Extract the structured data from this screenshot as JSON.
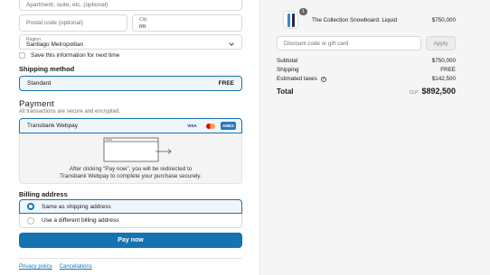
{
  "address": {
    "apartment_placeholder": "Apartment, suite, etc. (optional)",
    "postal_placeholder": "Postal code (optional)",
    "city_label": "City",
    "city_value": "rm",
    "region_label": "Region",
    "region_value": "Santiago Metropolitan",
    "save_info_label": "Save this information for next time"
  },
  "shipping": {
    "title": "Shipping method",
    "method": "Standard",
    "price": "FREE"
  },
  "payment": {
    "title": "Payment",
    "subtitle": "All transactions are secure and encrypted.",
    "method": "Transbank Webpay",
    "cards": [
      "VISA",
      "mastercard",
      "AMEX"
    ],
    "redirect_text_line1": "After clicking “Pay now”, you will be redirected to",
    "redirect_text_line2": "Transbank Webpay to complete your purchase securely."
  },
  "billing": {
    "title": "Billing address",
    "option_same": "Same as shipping address",
    "option_different": "Use a different billing address"
  },
  "pay_button": "Pay now",
  "footer": {
    "privacy": "Privacy policy",
    "cancellations": "Cancellations"
  },
  "order": {
    "quantity": "1",
    "product_name": "The Collection Snowboard: Liquid",
    "product_price": "$750,000",
    "discount_placeholder": "Discount code or gift card",
    "apply_label": "Apply",
    "subtotal_label": "Subtotal",
    "subtotal_value": "$750,000",
    "shipping_label": "Shipping",
    "shipping_value": "FREE",
    "taxes_label": "Estimated taxes",
    "taxes_value": "$142,500",
    "total_label": "Total",
    "currency": "CLP",
    "total_value": "$892,500"
  },
  "colors": {
    "accent": "#1773b0",
    "sidebar_bg": "#f5f5f5"
  }
}
